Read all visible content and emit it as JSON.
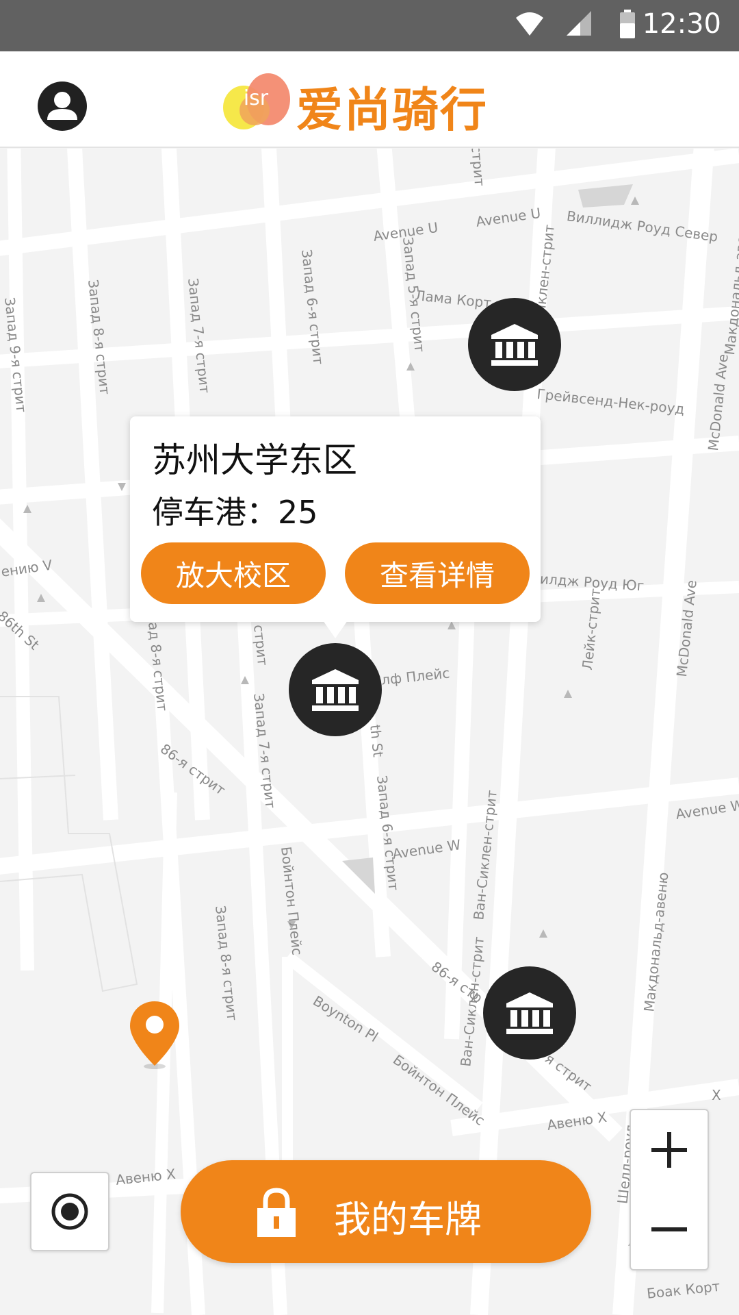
{
  "status_bar": {
    "time": "12:30",
    "icons": [
      "wifi-icon",
      "cellular-signal-icon",
      "battery-icon"
    ]
  },
  "header": {
    "logo_text": "isr",
    "app_name": "爱尚骑行",
    "profile_icon": "account-circle-icon"
  },
  "map": {
    "street_labels": [
      "Avenue U",
      "Avenue U",
      "стрит",
      "Виллидж Роуд Север",
      "Лама Корт",
      "Запад 8-я стрит",
      "Запад 7-я стрит",
      "Запад 6-я стрит",
      "Запад 5-я стрит",
      "Запад 9-я стрит",
      "иклен-стрит",
      "Грейвсенд-Нек-роуд",
      "McDonald Ave",
      "Макдональд-авеню",
      "ению V",
      "86th St",
      "илдж Роуд Юг",
      "Лейк-стрит",
      "лф Плейс",
      "ад 8-я стрит",
      "стрит",
      "Запад 7-я стрит",
      "th St",
      "Запад 6-я стрит",
      "86-я стрит",
      "Ван-Сиклен-стрит",
      "Avenue W",
      "Avenue W",
      "McDonald Ave",
      "Макдональд-авеню",
      "Бойнтон Плейс",
      "Ван-Сиклен-стрит",
      "Запад 8-я стрит",
      "86-я стр",
      "я стрит",
      "Boynton Pl",
      "Бойнтон Плейс",
      "Авеню X",
      "X",
      "Авеню X",
      "Шелл-роуд",
      "Боак Корт"
    ]
  },
  "popup": {
    "title": "苏州大学东区",
    "count_label": "停车港：",
    "count_value": "25",
    "zoom_button": "放大校区",
    "details_button": "查看详情"
  },
  "markers": {
    "station_icon": "bank-building-icon",
    "location_icon": "map-pin-icon"
  },
  "zoom": {
    "in_icon": "plus-icon",
    "out_icon": "minus-icon"
  },
  "locate": {
    "icon": "gps-locate-icon"
  },
  "action": {
    "label": "我的车牌",
    "icon": "lock-icon"
  },
  "colors": {
    "accent": "#f08519",
    "marker": "#262626",
    "status_bar": "#616161"
  }
}
